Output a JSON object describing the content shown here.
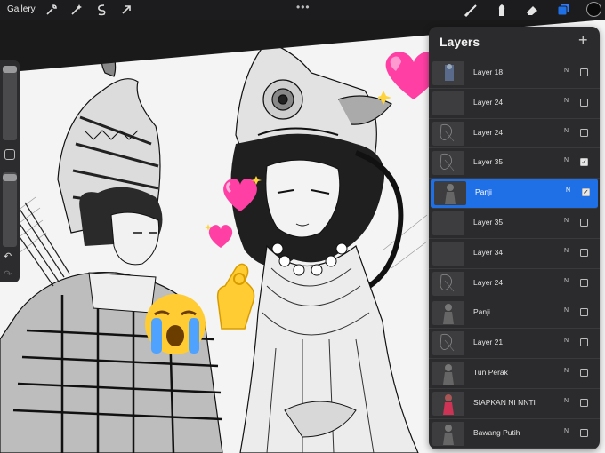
{
  "toolbar": {
    "gallery_label": "Gallery",
    "more_label": "•••",
    "tools_left": [
      "wrench-icon",
      "magic-wand-icon",
      "selection-icon",
      "transform-arrow-icon"
    ],
    "tools_right": [
      "brush-icon",
      "smudge-icon",
      "eraser-icon",
      "layers-icon"
    ],
    "active_tool": "layers-icon",
    "color_swatch": "#0a0a0a"
  },
  "sidebar": {
    "undo_label": "↶",
    "redo_label": "↷"
  },
  "layers_panel": {
    "title": "Layers",
    "add_label": "+",
    "layers": [
      {
        "name": "Layer 18",
        "blend": "N",
        "visible": false,
        "selected": false,
        "thumb": "blue-figure"
      },
      {
        "name": "Layer 24",
        "blend": "N",
        "visible": false,
        "selected": false,
        "thumb": "empty"
      },
      {
        "name": "Layer 24",
        "blend": "N",
        "visible": false,
        "selected": false,
        "thumb": "sketch"
      },
      {
        "name": "Layer 35",
        "blend": "N",
        "visible": true,
        "selected": false,
        "thumb": "sketch"
      },
      {
        "name": "Panji",
        "blend": "N",
        "visible": true,
        "selected": true,
        "thumb": "figure"
      },
      {
        "name": "Layer 35",
        "blend": "N",
        "visible": false,
        "selected": false,
        "thumb": "empty"
      },
      {
        "name": "Layer 34",
        "blend": "N",
        "visible": false,
        "selected": false,
        "thumb": "empty"
      },
      {
        "name": "Layer 24",
        "blend": "N",
        "visible": false,
        "selected": false,
        "thumb": "sketch"
      },
      {
        "name": "Panji",
        "blend": "N",
        "visible": false,
        "selected": false,
        "thumb": "figure"
      },
      {
        "name": "Layer 21",
        "blend": "N",
        "visible": false,
        "selected": false,
        "thumb": "sketch"
      },
      {
        "name": "Tun Perak",
        "blend": "N",
        "visible": false,
        "selected": false,
        "thumb": "figure"
      },
      {
        "name": "SIAPKAN NI NNTI",
        "blend": "N",
        "visible": false,
        "selected": false,
        "thumb": "red-figure"
      },
      {
        "name": "Bawang Putih",
        "blend": "N",
        "visible": false,
        "selected": false,
        "thumb": "figure"
      }
    ]
  },
  "colors": {
    "accent": "#1f6fe6",
    "panel": "#2b2b2d",
    "topbar": "#1c1c1e"
  }
}
